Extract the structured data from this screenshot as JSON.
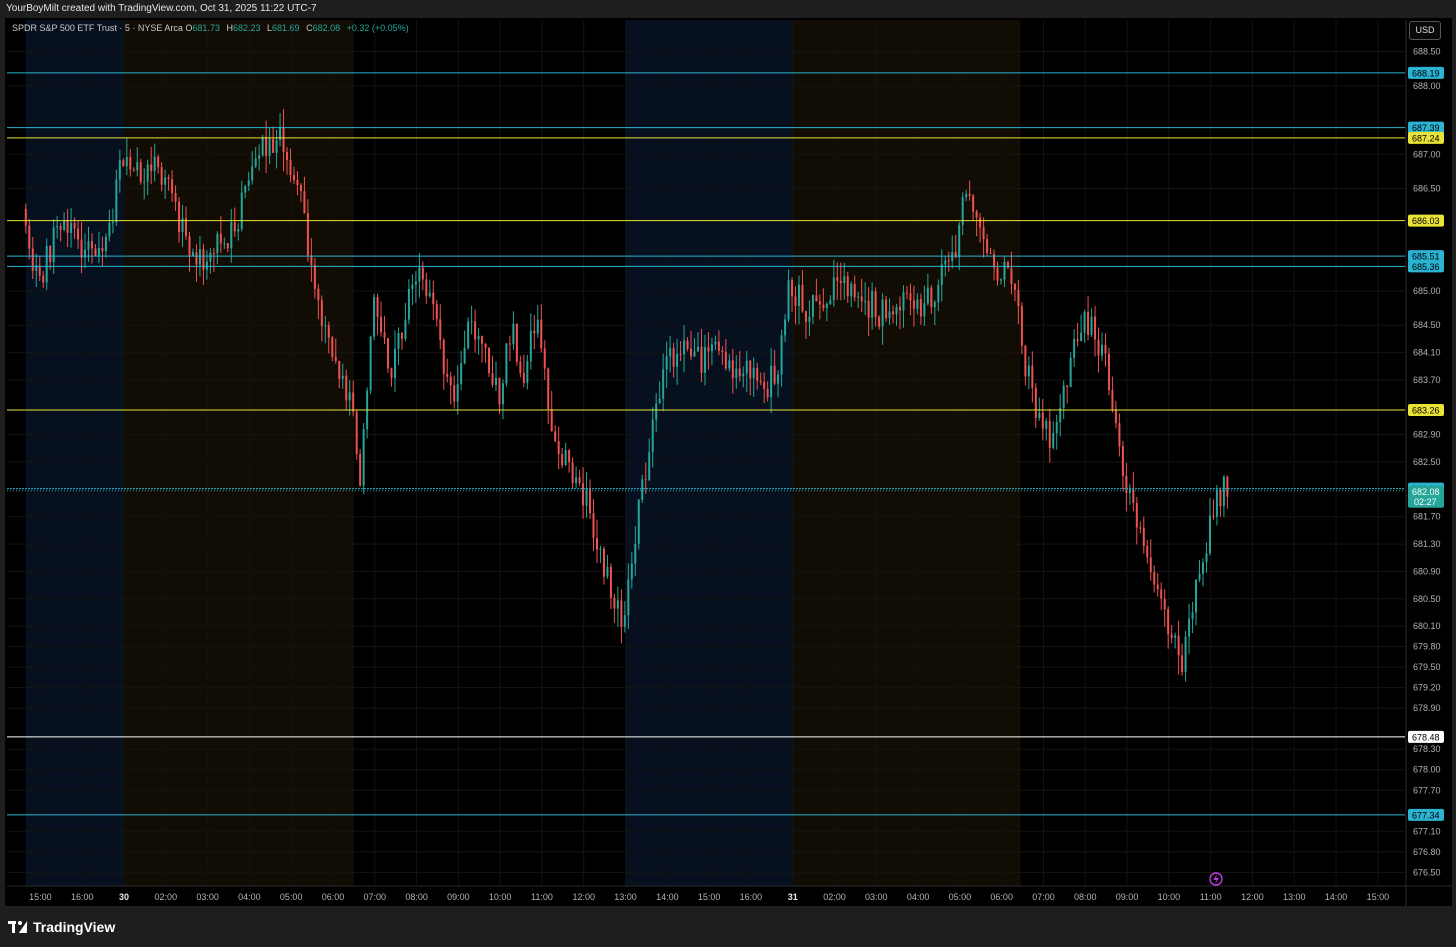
{
  "header": {
    "attribution": "YourBoyMilt created with TradingView.com, Oct 31, 2025 11:22 UTC-7"
  },
  "legend": {
    "symbol": "SPDR S&P 500 ETF Trust · 5 · NYSE Arca",
    "open_label": "O",
    "open_value": "681.73",
    "high_label": "H",
    "high_value": "682.23",
    "low_label": "L",
    "low_value": "681.69",
    "close_label": "C",
    "close_value": "682.08",
    "change": "+0.32 (+0.05%)"
  },
  "currency_button": "USD",
  "footer": {
    "brand": "TradingView"
  },
  "colors": {
    "background": "#000000",
    "up": "#26a69a",
    "down": "#ef5350",
    "cyan_level": "#2bb3d1",
    "yellow_level": "#e8e337",
    "white_level": "#ffffff",
    "session_asia": "#07101f",
    "session_london": "#120d04"
  },
  "chart_data": {
    "type": "candlestick",
    "interval": "5",
    "ylim": [
      676.3,
      688.7
    ],
    "y_ticks": [
      "688.50",
      "688.00",
      "687.00",
      "686.50",
      "685.00",
      "684.50",
      "684.10",
      "683.70",
      "682.90",
      "682.50",
      "681.70",
      "681.30",
      "680.90",
      "680.50",
      "680.10",
      "679.80",
      "679.50",
      "679.20",
      "678.90",
      "678.30",
      "678.00",
      "677.70",
      "677.10",
      "676.80",
      "676.50"
    ],
    "x_ticks": [
      {
        "label": "15:00",
        "t": 0.35
      },
      {
        "label": "16:00",
        "t": 1.35
      },
      {
        "label": "30",
        "t": 2.35,
        "bold": true
      },
      {
        "label": "02:00",
        "t": 3.35
      },
      {
        "label": "03:00",
        "t": 4.35
      },
      {
        "label": "04:00",
        "t": 5.35
      },
      {
        "label": "05:00",
        "t": 6.35
      },
      {
        "label": "06:00",
        "t": 7.35
      },
      {
        "label": "07:00",
        "t": 8.35
      },
      {
        "label": "08:00",
        "t": 9.35
      },
      {
        "label": "09:00",
        "t": 10.35
      },
      {
        "label": "10:00",
        "t": 11.35
      },
      {
        "label": "11:00",
        "t": 12.35
      },
      {
        "label": "12:00",
        "t": 13.35
      },
      {
        "label": "13:00",
        "t": 14.35
      },
      {
        "label": "14:00",
        "t": 15.35
      },
      {
        "label": "15:00",
        "t": 16.35
      },
      {
        "label": "16:00",
        "t": 17.35
      },
      {
        "label": "31",
        "t": 18.35,
        "bold": true
      },
      {
        "label": "02:00",
        "t": 19.35
      },
      {
        "label": "03:00",
        "t": 20.35
      },
      {
        "label": "04:00",
        "t": 21.35
      },
      {
        "label": "05:00",
        "t": 22.35
      },
      {
        "label": "06:00",
        "t": 23.35
      },
      {
        "label": "07:00",
        "t": 24.35
      },
      {
        "label": "08:00",
        "t": 25.35
      },
      {
        "label": "09:00",
        "t": 26.35
      },
      {
        "label": "10:00",
        "t": 27.35
      },
      {
        "label": "11:00",
        "t": 28.35
      },
      {
        "label": "12:00",
        "t": 29.35
      },
      {
        "label": "13:00",
        "t": 30.35
      },
      {
        "label": "14:00",
        "t": 31.35
      },
      {
        "label": "15:00",
        "t": 32.35
      }
    ],
    "sessions": [
      {
        "name": "asia",
        "from": 0.0,
        "to": 2.35
      },
      {
        "name": "london",
        "from": 2.35,
        "to": 7.85
      },
      {
        "name": "asia",
        "from": 14.35,
        "to": 18.35
      },
      {
        "name": "london",
        "from": 18.35,
        "to": 23.8
      }
    ],
    "levels": [
      {
        "price": 688.19,
        "label": "688.19",
        "color": "cyan"
      },
      {
        "price": 687.39,
        "label": "687.39",
        "color": "cyan"
      },
      {
        "price": 687.24,
        "label": "687.24",
        "color": "yellow"
      },
      {
        "price": 686.03,
        "label": "686.03",
        "color": "yellow"
      },
      {
        "price": 685.51,
        "label": "685.51",
        "color": "cyan"
      },
      {
        "price": 685.36,
        "label": "685.36",
        "color": "cyan"
      },
      {
        "price": 683.26,
        "label": "683.26",
        "color": "yellow"
      },
      {
        "price": 682.11,
        "label": "682.11",
        "color": "cyan"
      },
      {
        "price": 678.48,
        "label": "678.48",
        "color": "white"
      },
      {
        "price": 677.34,
        "label": "677.34",
        "color": "cyan"
      }
    ],
    "last_price": {
      "price": 682.08,
      "label": "682.08",
      "countdown": "02:27"
    },
    "price_path": [
      [
        0.0,
        686.2
      ],
      [
        0.4,
        685.1
      ],
      [
        0.8,
        685.9
      ],
      [
        1.2,
        685.8
      ],
      [
        1.6,
        685.6
      ],
      [
        2.0,
        685.7
      ],
      [
        2.2,
        686.3
      ],
      [
        2.4,
        687.0
      ],
      [
        2.8,
        686.7
      ],
      [
        3.2,
        686.9
      ],
      [
        3.6,
        686.3
      ],
      [
        4.0,
        685.7
      ],
      [
        4.3,
        685.4
      ],
      [
        4.6,
        685.7
      ],
      [
        5.0,
        685.8
      ],
      [
        5.4,
        686.5
      ],
      [
        5.8,
        687.2
      ],
      [
        6.2,
        687.2
      ],
      [
        6.5,
        686.8
      ],
      [
        6.8,
        685.8
      ],
      [
        7.1,
        684.6
      ],
      [
        7.5,
        684.1
      ],
      [
        7.9,
        683.3
      ],
      [
        8.1,
        682.2
      ],
      [
        8.4,
        685.1
      ],
      [
        8.8,
        683.7
      ],
      [
        9.2,
        684.8
      ],
      [
        9.6,
        685.3
      ],
      [
        10.0,
        684.2
      ],
      [
        10.3,
        683.3
      ],
      [
        10.7,
        684.6
      ],
      [
        11.0,
        684.1
      ],
      [
        11.4,
        683.5
      ],
      [
        11.7,
        684.4
      ],
      [
        12.0,
        683.8
      ],
      [
        12.3,
        684.6
      ],
      [
        12.6,
        683.3
      ],
      [
        12.9,
        682.6
      ],
      [
        13.2,
        682.3
      ],
      [
        13.5,
        681.9
      ],
      [
        13.8,
        681.2
      ],
      [
        14.1,
        680.7
      ],
      [
        14.35,
        680.0
      ],
      [
        14.5,
        680.9
      ],
      [
        14.8,
        681.9
      ],
      [
        15.1,
        683.2
      ],
      [
        15.4,
        684.0
      ],
      [
        15.8,
        684.1
      ],
      [
        16.2,
        684.0
      ],
      [
        16.6,
        684.1
      ],
      [
        17.0,
        683.9
      ],
      [
        17.4,
        683.9
      ],
      [
        17.8,
        683.6
      ],
      [
        18.1,
        684.0
      ],
      [
        18.35,
        685.2
      ],
      [
        18.7,
        684.7
      ],
      [
        19.1,
        684.8
      ],
      [
        19.5,
        685.2
      ],
      [
        19.9,
        684.9
      ],
      [
        20.3,
        684.8
      ],
      [
        20.7,
        684.6
      ],
      [
        21.1,
        684.8
      ],
      [
        21.5,
        684.7
      ],
      [
        21.9,
        685.1
      ],
      [
        22.3,
        685.6
      ],
      [
        22.6,
        686.5
      ],
      [
        22.9,
        686.0
      ],
      [
        23.2,
        685.3
      ],
      [
        23.5,
        685.2
      ],
      [
        23.8,
        684.9
      ],
      [
        24.0,
        683.9
      ],
      [
        24.3,
        683.2
      ],
      [
        24.6,
        682.8
      ],
      [
        24.9,
        683.5
      ],
      [
        25.2,
        684.4
      ],
      [
        25.5,
        684.5
      ],
      [
        25.8,
        684.2
      ],
      [
        26.0,
        683.7
      ],
      [
        26.3,
        682.3
      ],
      [
        26.6,
        681.7
      ],
      [
        26.9,
        681.0
      ],
      [
        27.2,
        680.6
      ],
      [
        27.5,
        680.0
      ],
      [
        27.7,
        679.5
      ],
      [
        27.9,
        680.1
      ],
      [
        28.1,
        680.6
      ],
      [
        28.3,
        681.2
      ],
      [
        28.5,
        681.8
      ],
      [
        28.7,
        682.1
      ],
      [
        28.8,
        682.08
      ]
    ]
  }
}
